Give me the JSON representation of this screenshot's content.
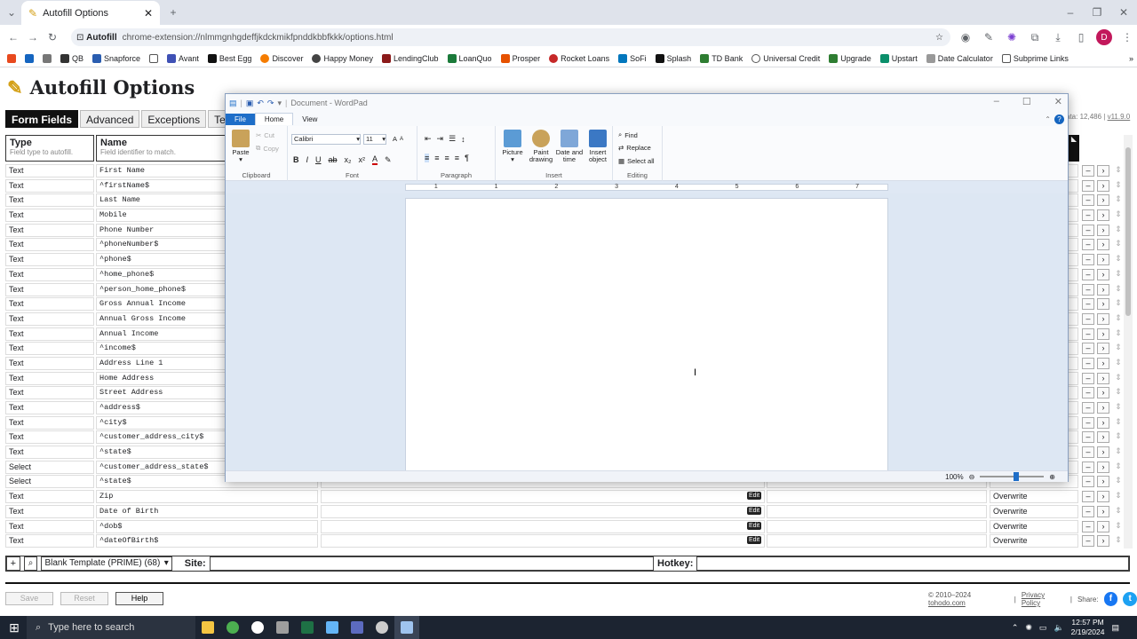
{
  "browser": {
    "tab_title": "Autofill Options",
    "site_chip": "Autofill",
    "url": "chrome-extension://nlmmgnhgdeffjkdckmikfpnddkbbfkkk/options.html",
    "profile_initial": "D"
  },
  "bookmarks": [
    "QB",
    "Snapforce",
    "",
    "Avant",
    "Best Egg",
    "Discover",
    "Happy Money",
    "LendingClub",
    "LoanQuo",
    "Prosper",
    "Rocket Loans",
    "SoFi",
    "Splash",
    "TD Bank",
    "Universal Credit",
    "Upgrade",
    "Upstart",
    "Date Calculator",
    "Subprime Links"
  ],
  "page": {
    "title": "Autofill Options",
    "tabs": [
      "Form Fields",
      "Advanced",
      "Exceptions",
      "Text Clip"
    ],
    "data_info": "ata: 12,486 |",
    "version": "v11.9.0",
    "columns": {
      "type": "Type",
      "type_hint": "Field type to autofill.",
      "name": "Name",
      "name_hint": "Field identifier to match."
    },
    "rows": [
      {
        "type": "Text",
        "name": "First Name"
      },
      {
        "type": "Text",
        "name": "^firstName$"
      },
      {
        "type": "Text",
        "name": "Last Name"
      },
      {
        "type": "Text",
        "name": "Mobile"
      },
      {
        "type": "Text",
        "name": "Phone Number"
      },
      {
        "type": "Text",
        "name": "^phoneNumber$"
      },
      {
        "type": "Text",
        "name": "^phone$"
      },
      {
        "type": "Text",
        "name": "^home_phone$"
      },
      {
        "type": "Text",
        "name": "^person_home_phone$"
      },
      {
        "type": "Text",
        "name": "Gross Annual Income"
      },
      {
        "type": "Text",
        "name": "Annual Gross Income"
      },
      {
        "type": "Text",
        "name": "Annual Income"
      },
      {
        "type": "Text",
        "name": "^income$"
      },
      {
        "type": "Text",
        "name": "Address Line 1"
      },
      {
        "type": "Text",
        "name": "Home Address"
      },
      {
        "type": "Text",
        "name": "Street Address"
      },
      {
        "type": "Text",
        "name": "^address$"
      },
      {
        "type": "Text",
        "name": "^city$"
      },
      {
        "type": "Text",
        "name": "^customer_address_city$"
      },
      {
        "type": "Text",
        "name": "^state$"
      },
      {
        "type": "Select",
        "name": "^customer_address_state$"
      },
      {
        "type": "Select",
        "name": "^state$"
      },
      {
        "type": "Text",
        "name": "Zip",
        "edit": "Edit",
        "mode": "Overwrite"
      },
      {
        "type": "Text",
        "name": "Date of Birth",
        "edit": "Edit",
        "mode": "Overwrite"
      },
      {
        "type": "Text",
        "name": "^dob$",
        "edit": "Edit",
        "mode": "Overwrite"
      },
      {
        "type": "Text",
        "name": "^dateOfBirth$",
        "edit": "Edit",
        "mode": "Overwrite"
      }
    ],
    "profile_select": "Blank Template (PRIME) (68)",
    "site_label": "Site:",
    "hotkey_label": "Hotkey:",
    "save": "Save",
    "reset": "Reset",
    "help": "Help",
    "copyright": "© 2010–2024",
    "tohodo": "tohodo.com",
    "privacy": "Privacy Policy",
    "share": "Share:"
  },
  "wordpad": {
    "title": "Document - WordPad",
    "menu": [
      "File",
      "Home",
      "View"
    ],
    "clipboard": {
      "paste": "Paste",
      "cut": "Cut",
      "copy": "Copy",
      "label": "Clipboard"
    },
    "font": {
      "name": "Calibri",
      "size": "11",
      "label": "Font"
    },
    "paragraph_label": "Paragraph",
    "insert": {
      "picture": "Picture",
      "paint": "Paint drawing",
      "datetime": "Date and time",
      "object": "Insert object",
      "label": "Insert"
    },
    "editing": {
      "find": "Find",
      "replace": "Replace",
      "selectall": "Select all",
      "label": "Editing"
    },
    "ruler": [
      "1",
      "1",
      "2",
      "3",
      "4",
      "5",
      "6",
      "7"
    ],
    "zoom": "100%"
  },
  "taskbar": {
    "search_placeholder": "Type here to search",
    "time": "12:57 PM",
    "date": "2/19/2024"
  }
}
